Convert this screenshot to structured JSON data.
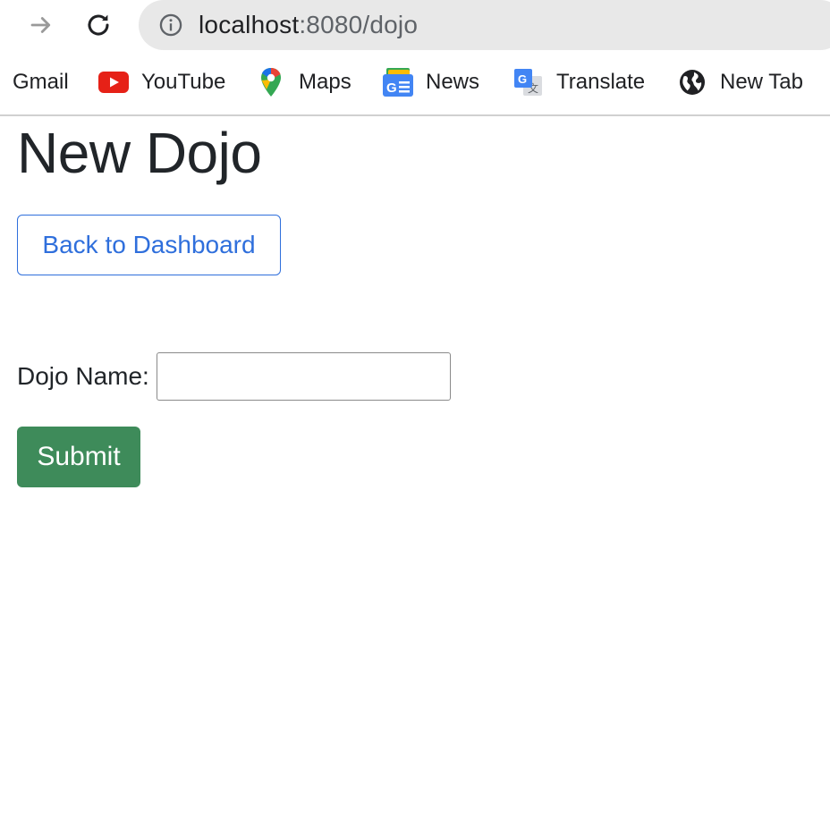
{
  "browser": {
    "url_host": "localhost",
    "url_rest": ":8080/dojo",
    "bookmarks": [
      {
        "label": "Gmail",
        "icon": "none"
      },
      {
        "label": "YouTube",
        "icon": "youtube-icon"
      },
      {
        "label": "Maps",
        "icon": "maps-pin-icon"
      },
      {
        "label": "News",
        "icon": "google-news-icon"
      },
      {
        "label": "Translate",
        "icon": "google-translate-icon"
      },
      {
        "label": "New Tab",
        "icon": "globe-icon"
      }
    ]
  },
  "page": {
    "title": "New Dojo",
    "back_button_label": "Back to Dashboard",
    "form": {
      "name_label": "Dojo Name:",
      "name_value": "",
      "submit_label": "Submit"
    }
  },
  "colors": {
    "primary_outline": "#2f6fdc",
    "success": "#3e8b5a",
    "text": "#212529",
    "omnibox_bg": "#e8e8e8"
  }
}
